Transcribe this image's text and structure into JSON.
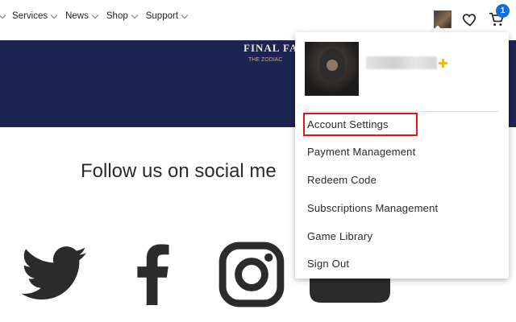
{
  "nav": {
    "items": [
      {
        "label": "Services"
      },
      {
        "label": "News"
      },
      {
        "label": "Shop"
      },
      {
        "label": "Support"
      }
    ],
    "cart_count": "1"
  },
  "hero": {
    "logo_text_line1": "FINAL FAN",
    "logo_text_line2": "THE ZODIAC"
  },
  "social": {
    "heading": "Follow us on social me"
  },
  "account_menu": {
    "items": [
      {
        "label": "Account Settings"
      },
      {
        "label": "Payment Management"
      },
      {
        "label": "Redeem Code"
      },
      {
        "label": "Subscriptions Management"
      },
      {
        "label": "Game Library"
      },
      {
        "label": "Sign Out"
      }
    ],
    "highlight_color": "#e0161d",
    "plus_color": "#f5b400"
  },
  "colors": {
    "hero_bg": "#1c2552",
    "badge": "#0d6fd8",
    "icon_dark": "#2b2b2b"
  }
}
